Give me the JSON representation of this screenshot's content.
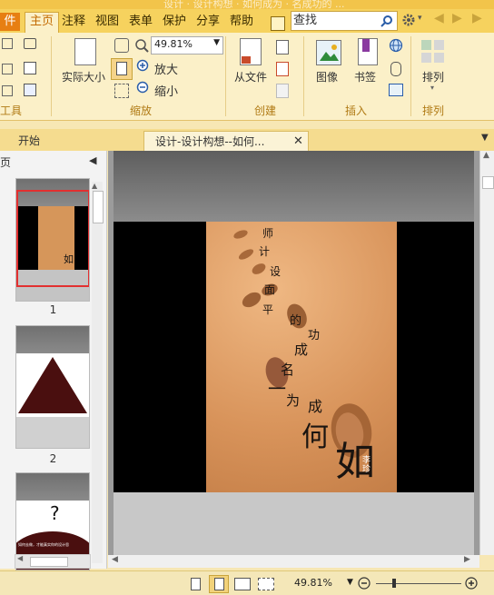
{
  "title_bar": {
    "text": "设计 · 设计构想 · 如何成为 · 名成功的 ..."
  },
  "menu": {
    "file": "件",
    "tabs": [
      "主页",
      "注释",
      "视图",
      "表单",
      "保护",
      "分享",
      "帮助"
    ]
  },
  "search": {
    "placeholder": "查找"
  },
  "ribbon": {
    "tools_group": "工具",
    "actual_size": "实际大小",
    "zoom_value": "49.81%",
    "zoom_in": "放大",
    "zoom_out": "缩小",
    "zoom_group": "缩放",
    "from_file": "从文件",
    "create_group": "创建",
    "image": "图像",
    "bookmark": "书签",
    "insert_group": "插入",
    "arrange": "排列",
    "arrange_group": "排列"
  },
  "tabs": {
    "start": "开始",
    "doc": "设计-设计构想--如何..."
  },
  "sidebar": {
    "header": "页",
    "pages": [
      "1",
      "2"
    ],
    "thumb3_text": "如何去做，才能真实你的设计思"
  },
  "poem": {
    "chars": [
      "师",
      "计",
      "设",
      "面",
      "平",
      "的",
      "功",
      "成",
      "名",
      "一",
      "为",
      "成",
      "何",
      "如"
    ],
    "signature": "李珍"
  },
  "status": {
    "zoom": "49.81%"
  },
  "colors": {
    "accent": "#e77f12",
    "ribbon": "#fbf0c8",
    "menubar": "#f6d25e"
  }
}
